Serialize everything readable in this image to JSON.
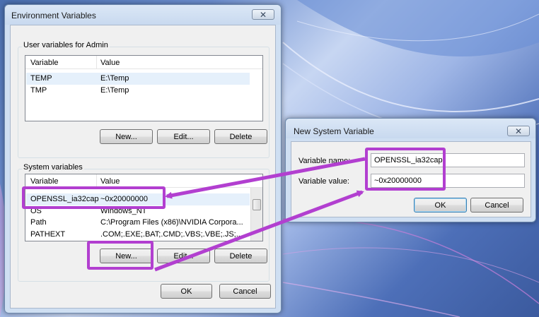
{
  "env_dialog": {
    "title": "Environment Variables",
    "close_icon": "close-icon",
    "user_group": {
      "label": "User variables for Admin",
      "col_variable": "Variable",
      "col_value": "Value",
      "rows": [
        {
          "variable": "TEMP",
          "value": "E:\\Temp"
        },
        {
          "variable": "TMP",
          "value": "E:\\Temp"
        }
      ],
      "new_label": "New...",
      "edit_label": "Edit...",
      "delete_label": "Delete"
    },
    "system_group": {
      "label": "System variables",
      "col_variable": "Variable",
      "col_value": "Value",
      "rows": [
        {
          "variable": "OPENSSL_ia32cap",
          "value": "~0x20000000"
        },
        {
          "variable": "OS",
          "value": "Windows_NT"
        },
        {
          "variable": "Path",
          "value": "C:\\Program Files (x86)\\NVIDIA Corpora..."
        },
        {
          "variable": "PATHEXT",
          "value": ".COM;.EXE;.BAT;.CMD;.VBS;.VBE;.JS;...."
        }
      ],
      "new_label": "New...",
      "edit_label": "Edit...",
      "delete_label": "Delete"
    },
    "ok_label": "OK",
    "cancel_label": "Cancel"
  },
  "new_var_dialog": {
    "title": "New System Variable",
    "close_icon": "close-icon",
    "name_label": "Variable name:",
    "name_value": "OPENSSL_ia32cap",
    "value_label": "Variable value:",
    "value_value": "~0x20000000",
    "ok_label": "OK",
    "cancel_label": "Cancel"
  },
  "colors": {
    "highlight": "#b23fd0",
    "window_frame": "#cfdff2",
    "client_bg": "#f0f0f0"
  }
}
